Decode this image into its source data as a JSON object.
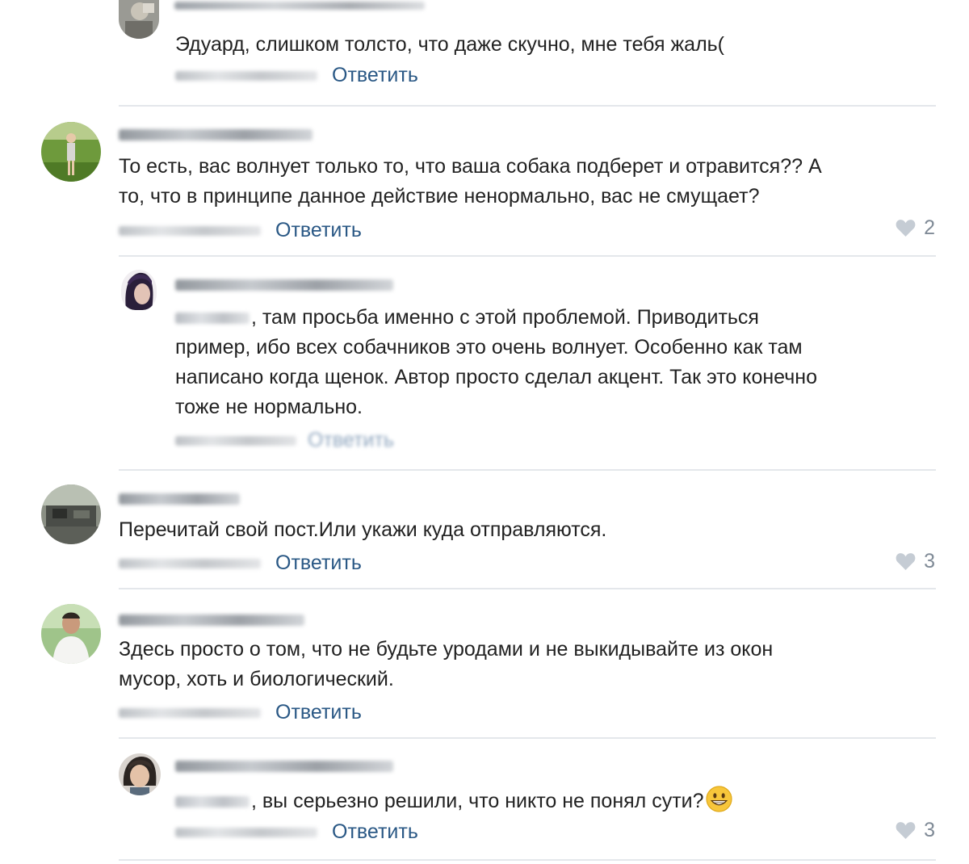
{
  "comments": [
    {
      "text": "Эдуард, слишком толсто, что даже скучно, мне тебя жаль(",
      "reply": "Ответить"
    },
    {
      "line1": "То есть, вас волнует только то, что ваша собака подберет и отравится?? А",
      "line2": "то, что в принципе данное действие ненормально, вас не смущает?",
      "reply": "Ответить",
      "likes": "2"
    },
    {
      "line1": ", там просьба именно с этой проблемой. Приводиться",
      "line2": "пример, ибо всех собачников это очень волнует. Особенно как там",
      "line3": "написано когда щенок. Автор просто сделал акцент. Так это конечно",
      "line4": "тоже не нормально.",
      "reply": "Ответить"
    },
    {
      "text": "Перечитай свой пост.Или укажи куда отправляются.",
      "reply": "Ответить",
      "likes": "3"
    },
    {
      "line1": "Здесь просто о том, что не будьте уродами и не выкидывайте из окон",
      "line2": "мусор, хоть и биологический.",
      "reply": "Ответить"
    },
    {
      "text": ", вы серьезно решили, что никто не понял сути?",
      "emoji": "grinning-face-emoji",
      "reply": "Ответить",
      "likes": "3"
    }
  ],
  "colors": {
    "link": "#2a5885",
    "text": "#222222",
    "muted": "#7f8a96",
    "divider": "#e4e7eb",
    "heart": "#c5ccd4"
  },
  "icons": {
    "like": "heart-icon",
    "emoji": "grinning-face-emoji"
  }
}
